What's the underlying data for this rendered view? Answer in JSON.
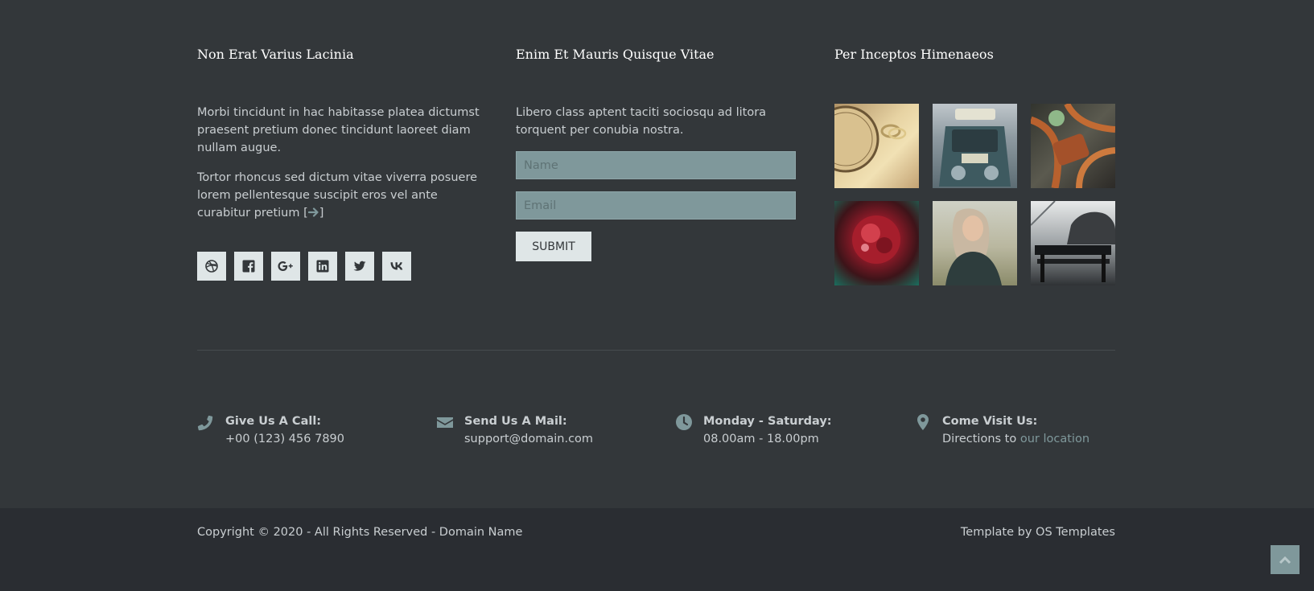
{
  "columns": {
    "about": {
      "title": "Non Erat Varius Lacinia",
      "para1": "Morbi tincidunt in hac habitasse platea dictumst praesent pretium donec tincidunt laoreet diam nullam augue.",
      "para2": "Tortor rhoncus sed dictum vitae viverra posuere lorem pellentesque suscipit eros vel ante curabitur pretium [",
      "para2_end": "]"
    },
    "newsletter": {
      "title": "Enim Et Mauris Quisque Vitae",
      "text": "Libero class aptent taciti sociosqu ad litora torquent per conubia nostra.",
      "name_placeholder": "Name",
      "email_placeholder": "Email",
      "submit_label": "Submit"
    },
    "gallery": {
      "title": "Per Inceptos Himenaeos",
      "images": [
        "watch-and-rings",
        "vintage-taxi",
        "leather-straps",
        "red-flower",
        "smiling-woman",
        "street-bench"
      ]
    }
  },
  "social": [
    "dribbble-icon",
    "facebook-icon",
    "google-plus-icon",
    "linkedin-icon",
    "twitter-icon",
    "vk-icon"
  ],
  "contacts": [
    {
      "icon": "phone-icon",
      "title": "Give Us A Call:",
      "text": "+00 (123) 456 7890"
    },
    {
      "icon": "envelope-icon",
      "title": "Send Us A Mail:",
      "text": "support@domain.com"
    },
    {
      "icon": "clock-icon",
      "title": "Monday - Saturday:",
      "text": "08.00am - 18.00pm"
    },
    {
      "icon": "map-marker-icon",
      "title": "Come Visit Us:",
      "text": "Directions to ",
      "link": "our location"
    }
  ],
  "bottom": {
    "copyright": "Copyright © 2020 - All Rights Reserved - Domain Name",
    "credit": "Template by OS Templates"
  },
  "colors": {
    "background": "#33373a",
    "bottom_bar": "#2a2d32",
    "accent": "#7f989b",
    "button": "#dfe6e7"
  }
}
